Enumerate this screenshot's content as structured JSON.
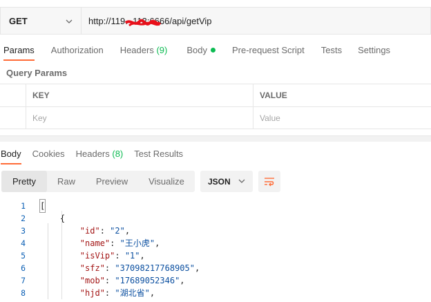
{
  "request": {
    "method": "GET",
    "url": "http://119.  .113:6666/api/getVip"
  },
  "request_tabs": [
    {
      "label": "Params",
      "active": true
    },
    {
      "label": "Authorization"
    },
    {
      "label": "Headers ",
      "count": "(9)"
    },
    {
      "label": "Body",
      "dot": true
    },
    {
      "label": "Pre-request Script"
    },
    {
      "label": "Tests"
    },
    {
      "label": "Settings"
    }
  ],
  "query_params": {
    "title": "Query Params",
    "key_header": "KEY",
    "value_header": "VALUE",
    "key_placeholder": "Key",
    "value_placeholder": "Value"
  },
  "response_tabs": [
    {
      "label": "Body",
      "active": true
    },
    {
      "label": "Cookies"
    },
    {
      "label": "Headers ",
      "count": "(8)"
    },
    {
      "label": "Test Results"
    }
  ],
  "view_modes": [
    "Pretty",
    "Raw",
    "Preview",
    "Visualize"
  ],
  "format": "JSON",
  "code_lines": [
    {
      "n": "1",
      "text": "["
    },
    {
      "n": "2",
      "text": "    {"
    },
    {
      "n": "3",
      "key": "\"id\"",
      "val": "\"2\""
    },
    {
      "n": "4",
      "key": "\"name\"",
      "val": "\"王小虎\""
    },
    {
      "n": "5",
      "key": "\"isVip\"",
      "val": "\"1\""
    },
    {
      "n": "6",
      "key": "\"sfz\"",
      "val": "\"37098217768905\""
    },
    {
      "n": "7",
      "key": "\"mob\"",
      "val": "\"17689052346\""
    },
    {
      "n": "8",
      "key": "\"hjd\"",
      "val": "\"湖北省\""
    }
  ],
  "colors": {
    "accent": "#ff6c37",
    "success": "#0cbb52",
    "redaction": "#e8101a"
  }
}
